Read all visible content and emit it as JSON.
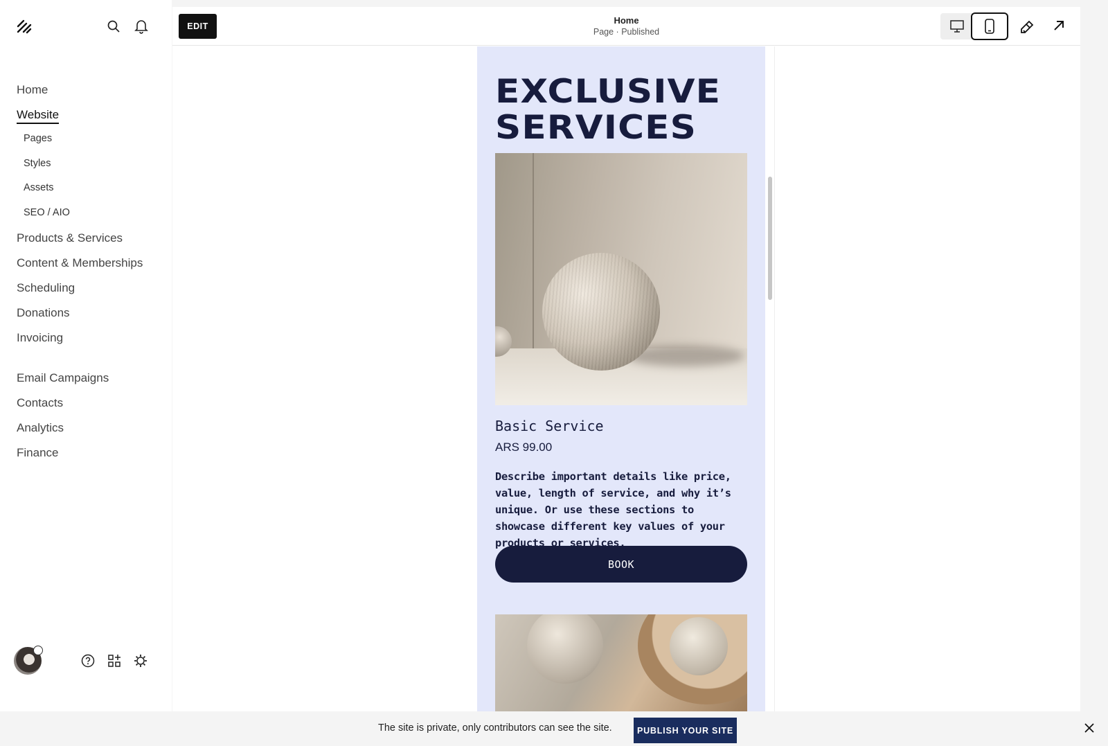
{
  "sidebar": {
    "nav": [
      {
        "label": "Home",
        "active": false
      },
      {
        "label": "Website",
        "active": true
      }
    ],
    "website_sub": [
      "Pages",
      "Styles",
      "Assets",
      "SEO / AIO"
    ],
    "nav_more": [
      "Products & Services",
      "Content & Memberships",
      "Scheduling",
      "Donations",
      "Invoicing"
    ],
    "nav_bottom": [
      "Email Campaigns",
      "Contacts",
      "Analytics",
      "Finance"
    ],
    "icons": {
      "logo": "squarespace-logo-icon",
      "search": "search-icon",
      "notifications": "bell-icon",
      "help": "help-icon",
      "apps": "apps-icon",
      "settings": "gear-icon"
    }
  },
  "topbar": {
    "edit_label": "EDIT",
    "page_title": "Home",
    "page_status": "Page · Published",
    "view_mode": "mobile"
  },
  "site": {
    "headline_line1": "EXCLUSIVE",
    "headline_line2": "SERVICES",
    "service_title": "Basic Service",
    "service_price": "ARS 99.00",
    "service_description": "Describe important details like price, value, length of service, and why it’s unique. Or use these sections to showcase different key values of your products or services.",
    "book_label": "BOOK",
    "colors": {
      "background": "#e3e7fa",
      "text": "#171c3d",
      "button": "#171c3d"
    }
  },
  "banner": {
    "text": "The site is private, only contributors can see the site.",
    "publish_label": "PUBLISH YOUR SITE"
  }
}
